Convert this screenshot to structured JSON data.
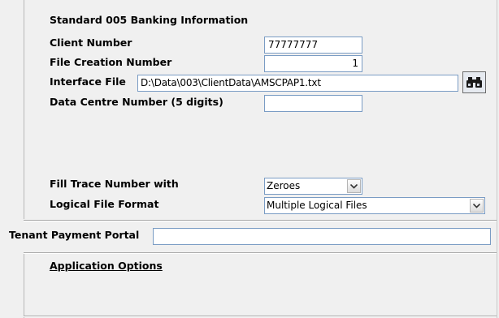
{
  "section_title": "Standard 005 Banking Information",
  "fields": {
    "client_number": {
      "label": "Client Number",
      "value": "77777777"
    },
    "file_creation_number": {
      "label": "File Creation Number",
      "value": "1"
    },
    "interface_file": {
      "label": "Interface File",
      "value": "D:\\Data\\003\\ClientData\\AMSCPAP1.txt"
    },
    "data_centre_number": {
      "label": "Data Centre Number (5 digits)",
      "value": ""
    },
    "fill_trace_number": {
      "label": "Fill Trace Number with",
      "value": "Zeroes"
    },
    "logical_file_format": {
      "label": "Logical File Format",
      "value": "Multiple Logical Files"
    },
    "tenant_payment_portal": {
      "label": "Tenant Payment Portal",
      "value": ""
    }
  },
  "application_options": "Application Options",
  "icons": {
    "browse": "binoculars-icon",
    "dropdown": "chevron-down-icon"
  }
}
